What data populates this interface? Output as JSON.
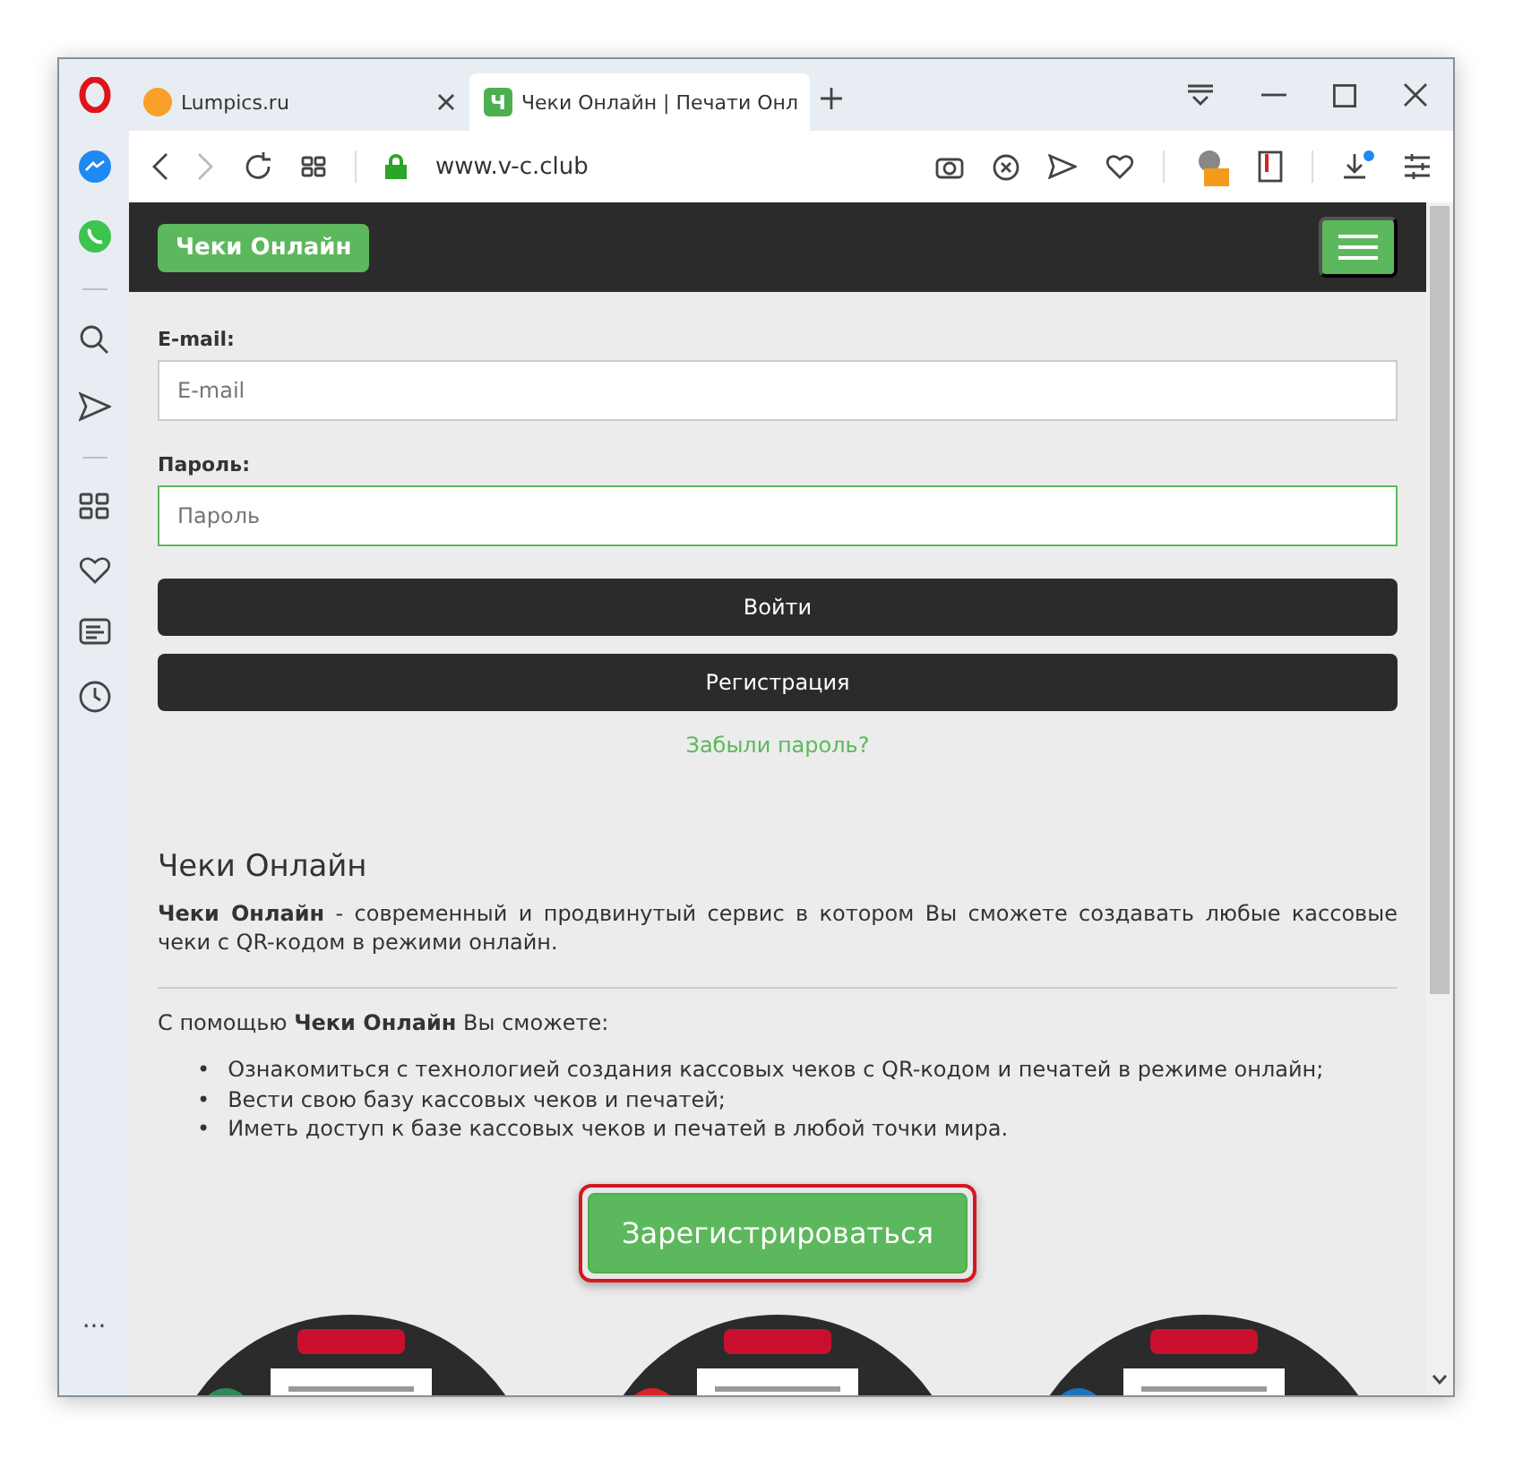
{
  "browser": {
    "tabs": [
      {
        "title": "Lumpics.ru",
        "selected": false,
        "kind": "orange"
      },
      {
        "title": "Чеки Онлайн | Печати Онл",
        "selected": true,
        "kind": "letter",
        "icon_letter": "Ч"
      }
    ],
    "url": "www.v-c.club",
    "sidebar_more": "···"
  },
  "site": {
    "brand": "Чеки Онлайн",
    "fields": [
      {
        "label": "E-mail:",
        "placeholder": "E-mail",
        "focused": false
      },
      {
        "label": "Пароль:",
        "placeholder": "Пароль",
        "focused": true
      }
    ],
    "buttons": [
      "Войти",
      "Регистрация"
    ],
    "forgot_link": "Забыли пароль?",
    "heading": "Чеки Онлайн",
    "intro": "**Чеки Онлайн** - современный и продвинутый сервис в котором Вы сможете создавать любые кассовые чеки с QR-кодом в режими онлайн.",
    "help_intro": "С помощью **Чеки Онлайн** Вы сможете:",
    "bullet_mark": "•",
    "bullets": [
      "Ознакомиться с технологией создания кассовых чеков с QR-кодом и печатей в режиме онлайн;",
      "Вести свою базу кассовых чеков и печатей;",
      "Иметь доступ к базе кассовых чеков и печатей в любой точки мира."
    ],
    "cta": {
      "label": "Зарегистрироваться",
      "highlighted": true
    },
    "gallery": [
      {
        "kind": "picture"
      },
      {
        "kind": "picture"
      },
      {
        "kind": "picture"
      }
    ]
  }
}
